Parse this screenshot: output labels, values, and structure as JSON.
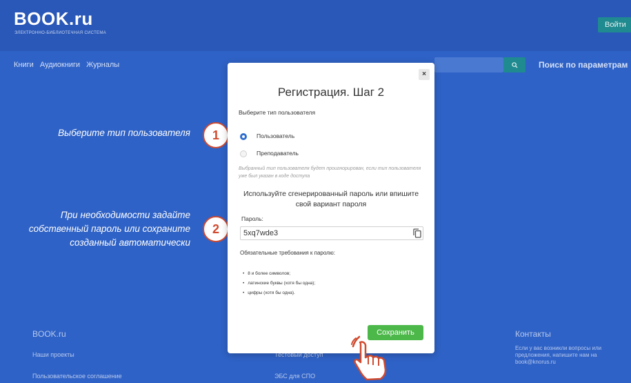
{
  "header": {
    "logo": "BOOK.ru",
    "logo_sub": "ЭЛЕКТРОННО-БИБЛИОТЕЧНАЯ СИСТЕМА",
    "login": "Войти"
  },
  "nav": {
    "items": [
      "Книги",
      "Аудиокниги",
      "Журналы"
    ],
    "param_search": "Поиск по параметрам"
  },
  "footer": {
    "col1_title": "BOOK.ru",
    "col1_link1": "Наши проекты",
    "col1_link2": "Пользовательское соглашение",
    "col2_link1": "Тестовый доступ",
    "col2_link2": "ЭБС для СПО",
    "col3_title": "Контакты",
    "col3_text": "Если у вас возникли вопросы или предложения, напишите нам на book@knorus.ru"
  },
  "instructions": {
    "step1": "Выберите тип пользователя",
    "step2": "При необходимости задайте собственный пароль или сохраните созданный автоматически",
    "badge1": "1",
    "badge2": "2"
  },
  "modal": {
    "close": "×",
    "title": "Регистрация. Шаг 2",
    "type_label": "Выберите тип пользователя",
    "option1": "Пользователь",
    "option2": "Преподаватель",
    "hint": "Выбранный тип пользователя будет проигнорирован, если тип пользователя уже был указан в коде доступа",
    "pwd_info": "Используйте  сгенерированный пароль  или впишите свой вариант пароля",
    "pwd_label": "Пароль:",
    "pwd_value": "5xq7wde3",
    "req_title": "Обязательные требования к паролю:",
    "req1": "8 и более символов;",
    "req2": "латинские буквы (хотя бы одна);",
    "req3": "цифры (хотя бы одна).",
    "save": "Сохранить"
  },
  "colors": {
    "background": "#2f62c6",
    "accent_green": "#4db84a",
    "radio_blue": "#2f6ecf",
    "badge_red": "#d04a2f"
  }
}
